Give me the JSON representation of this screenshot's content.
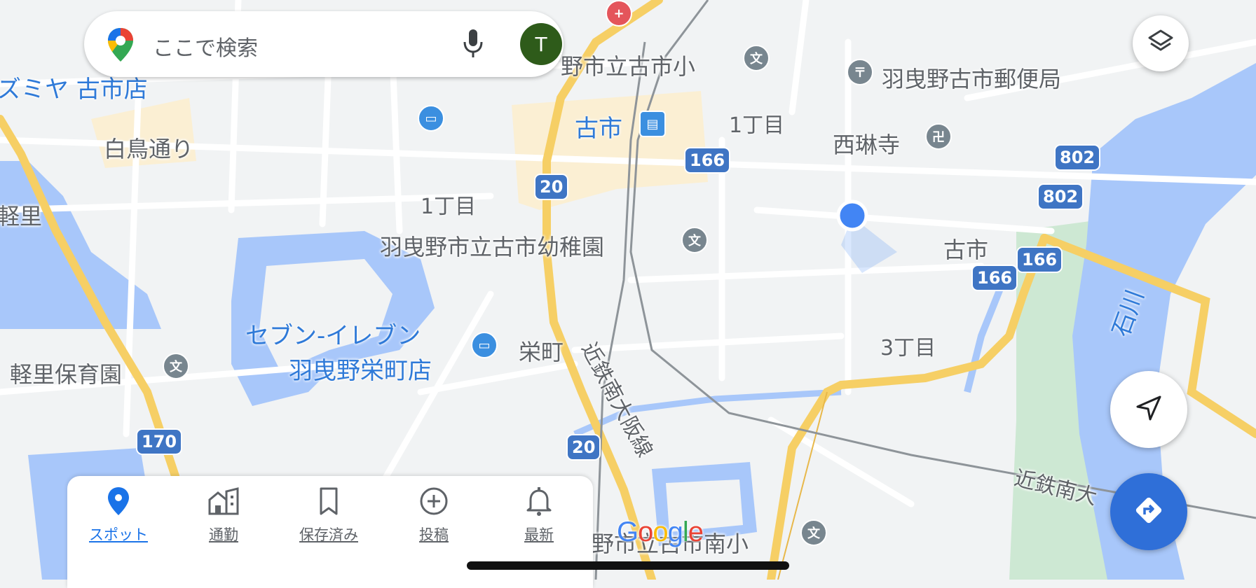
{
  "search": {
    "placeholder": "ここで検索",
    "avatar_initial": "T"
  },
  "places": {
    "furuichi_elem": "野市立古市小",
    "post_office": "羽曳野古市郵便局",
    "station": "古市",
    "chome1_north": "1丁目",
    "saiRinji": "西琳寺",
    "shiratori": "白鳥通り",
    "chome1_west": "1丁目",
    "karusato": "軽里",
    "kindergarten": "羽曳野市立古市幼稚園",
    "furuichi_district": "古市",
    "seven_line1": "セブン-イレブン",
    "seven_line2": "羽曳野栄町店",
    "sakaemachi": "栄町",
    "chome3": "3丁目",
    "nursery": "軽里保育園",
    "izumiya": "ズミヤ 古市店",
    "railway_1": "近鉄南大阪線",
    "railway_2": "近鉄南大",
    "river": "石川",
    "south_elem": "野市立古市南小"
  },
  "route_shields": {
    "r166_a": "166",
    "r20_a": "20",
    "r802_a": "802",
    "r802_b": "802",
    "r166_b": "166",
    "r166_c": "166",
    "r170": "170",
    "r20_b": "20"
  },
  "bottom_nav": [
    {
      "label": "スポット",
      "icon": "location-pin-icon",
      "active": true
    },
    {
      "label": "通勤",
      "icon": "commute-building-icon",
      "active": false
    },
    {
      "label": "保存済み",
      "icon": "bookmark-icon",
      "active": false
    },
    {
      "label": "投稿",
      "icon": "add-circle-icon",
      "active": false
    },
    {
      "label": "最新",
      "icon": "bell-icon",
      "active": false
    }
  ],
  "google_logo": "Google",
  "colors": {
    "map_bg": "#f1f3f4",
    "road_major": "#f6cf65",
    "water": "#a8c7fa",
    "park": "#cde8d3",
    "accent_blue": "#1a73e8",
    "route_shield": "#3f75c4",
    "fab_blue": "#2f6fd8"
  }
}
